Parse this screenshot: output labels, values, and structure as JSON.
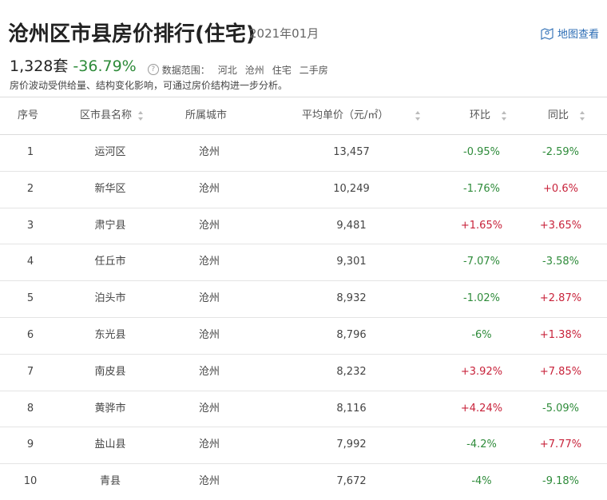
{
  "header": {
    "title": "沧州区市县房价排行(住宅)",
    "date": "2021年01月",
    "map_link": "地图查看"
  },
  "stats": {
    "count": "1,328套",
    "change": "-36.79%",
    "scope_label": "数据范围：",
    "scope_tags": [
      "河北",
      "沧州",
      "住宅",
      "二手房"
    ]
  },
  "note": "房价波动受供给量、结构变化影响，可通过房价结构进一步分析。",
  "table": {
    "columns": [
      "序号",
      "区市县名称",
      "所属城市",
      "平均单价（元/㎡）",
      "环比",
      "同比"
    ],
    "rows": [
      {
        "idx": "1",
        "name": "运河区",
        "city": "沧州",
        "price": "13,457",
        "mom": "-0.95%",
        "yoy": "-2.59%"
      },
      {
        "idx": "2",
        "name": "新华区",
        "city": "沧州",
        "price": "10,249",
        "mom": "-1.76%",
        "yoy": "+0.6%"
      },
      {
        "idx": "3",
        "name": "肃宁县",
        "city": "沧州",
        "price": "9,481",
        "mom": "+1.65%",
        "yoy": "+3.65%"
      },
      {
        "idx": "4",
        "name": "任丘市",
        "city": "沧州",
        "price": "9,301",
        "mom": "-7.07%",
        "yoy": "-3.58%"
      },
      {
        "idx": "5",
        "name": "泊头市",
        "city": "沧州",
        "price": "8,932",
        "mom": "-1.02%",
        "yoy": "+2.87%"
      },
      {
        "idx": "6",
        "name": "东光县",
        "city": "沧州",
        "price": "8,796",
        "mom": "-6%",
        "yoy": "+1.38%"
      },
      {
        "idx": "7",
        "name": "南皮县",
        "city": "沧州",
        "price": "8,232",
        "mom": "+3.92%",
        "yoy": "+7.85%"
      },
      {
        "idx": "8",
        "name": "黄骅市",
        "city": "沧州",
        "price": "8,116",
        "mom": "+4.24%",
        "yoy": "-5.09%"
      },
      {
        "idx": "9",
        "name": "盐山县",
        "city": "沧州",
        "price": "7,992",
        "mom": "-4.2%",
        "yoy": "+7.77%"
      },
      {
        "idx": "10",
        "name": "青县",
        "city": "沧州",
        "price": "7,672",
        "mom": "-4%",
        "yoy": "-9.18%"
      }
    ]
  },
  "colors": {
    "negative": "#2e8b3a",
    "positive": "#c8233b",
    "link": "#2c6db5"
  }
}
